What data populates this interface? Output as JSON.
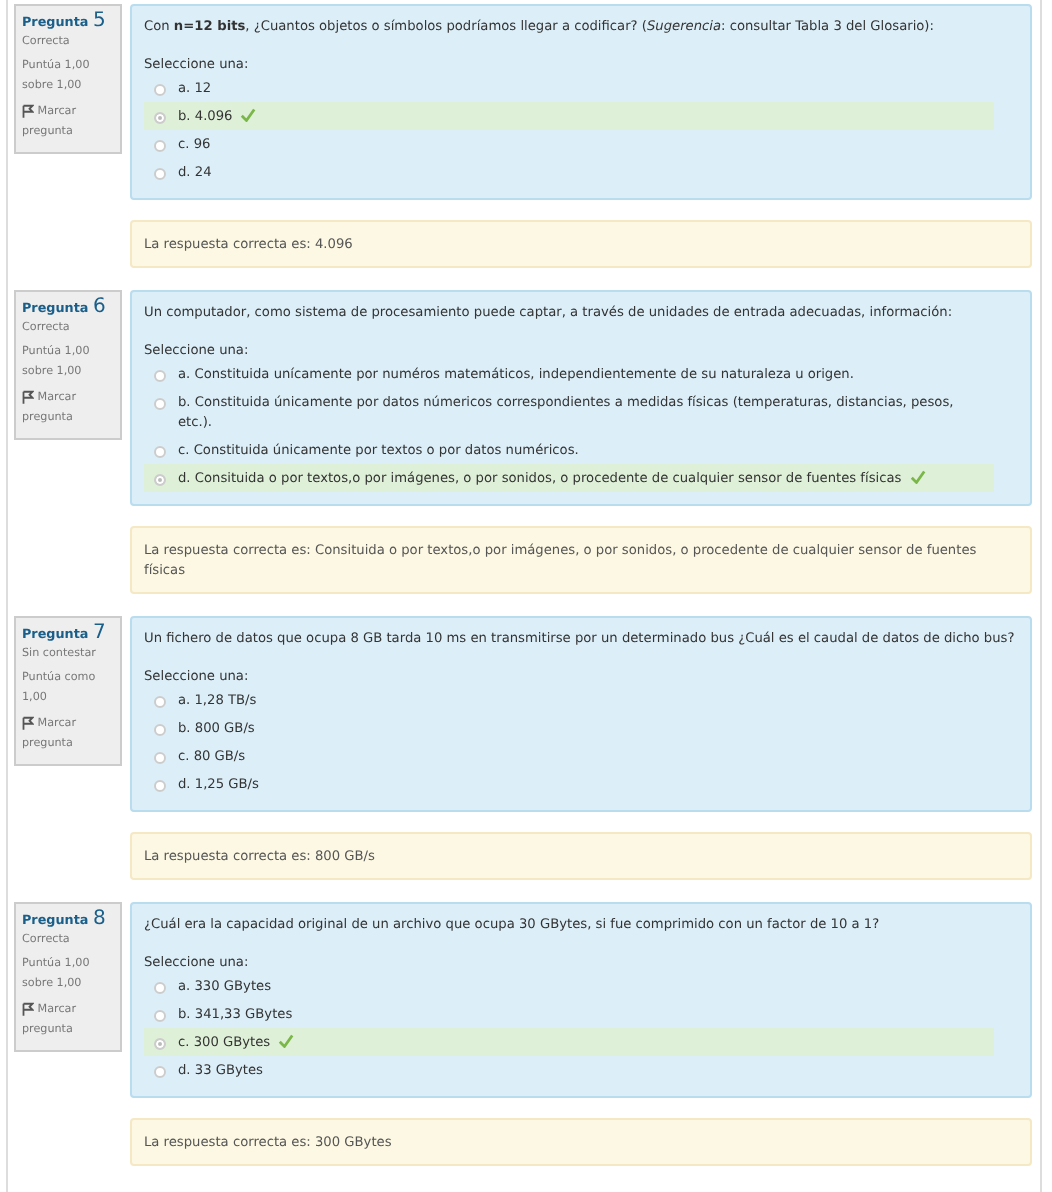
{
  "questions": [
    {
      "label": "Pregunta",
      "number": "5",
      "state": "Correcta",
      "grade": "Puntúa 1,00 sobre 1,00",
      "flag": "Marcar pregunta",
      "prompt": "Con **n=12 bits**, ¿Cuantos objetos o símbolos podríamos llegar a codificar? (*Sugerencia*: consultar Tabla 3 del Glosario):",
      "select_label": "Seleccione una:",
      "options": [
        {
          "label": "a. 12",
          "selected": false
        },
        {
          "label": "b. 4.096",
          "selected": true
        },
        {
          "label": "c. 96",
          "selected": false
        },
        {
          "label": "d. 24",
          "selected": false
        }
      ],
      "feedback": "La respuesta correcta es: 4.096"
    },
    {
      "label": "Pregunta",
      "number": "6",
      "state": "Correcta",
      "grade": "Puntúa 1,00 sobre 1,00",
      "flag": "Marcar pregunta",
      "prompt": "Un computador, como sistema de procesamiento puede captar, a través de unidades de entrada adecuadas, información:",
      "select_label": "Seleccione una:",
      "options": [
        {
          "label": "a. Constituida unícamente por numéros matemáticos, independientemente de su naturaleza u origen.",
          "selected": false
        },
        {
          "label": "b. Constituida únicamente por datos númericos correspondientes a medidas físicas (temperaturas, distancias, pesos, etc.).",
          "selected": false
        },
        {
          "label": "c. Constituida únicamente por textos o por datos numéricos.",
          "selected": false
        },
        {
          "label": "d. Consituida o por textos,o por imágenes, o por sonidos, o procedente de cualquier sensor de fuentes físicas",
          "selected": true
        }
      ],
      "feedback": "La respuesta correcta es: Consituida o por textos,o por imágenes, o por sonidos, o procedente de cualquier sensor de fuentes físicas"
    },
    {
      "label": "Pregunta",
      "number": "7",
      "state": "Sin contestar",
      "grade": "Puntúa como 1,00",
      "flag": "Marcar pregunta",
      "prompt": "Un fichero de datos que ocupa 8 GB tarda 10 ms en transmitirse por un determinado bus ¿Cuál es el caudal de datos de dicho bus?",
      "select_label": "Seleccione una:",
      "options": [
        {
          "label": "a. 1,28 TB/s",
          "selected": false
        },
        {
          "label": "b. 800 GB/s",
          "selected": false
        },
        {
          "label": "c. 80 GB/s",
          "selected": false
        },
        {
          "label": "d. 1,25 GB/s",
          "selected": false
        }
      ],
      "feedback": "La respuesta correcta es: 800 GB/s"
    },
    {
      "label": "Pregunta",
      "number": "8",
      "state": "Correcta",
      "grade": "Puntúa 1,00 sobre 1,00",
      "flag": "Marcar pregunta",
      "prompt": "¿Cuál era la capacidad original de un archivo que ocupa 30 GBytes, si fue comprimido con un factor de 10 a 1?",
      "select_label": "Seleccione una:",
      "options": [
        {
          "label": "a. 330 GBytes",
          "selected": false
        },
        {
          "label": "b. 341,33 GBytes",
          "selected": false
        },
        {
          "label": "c. 300 GBytes",
          "selected": true
        },
        {
          "label": "d. 33 GBytes",
          "selected": false
        }
      ],
      "feedback": "La respuesta correcta es: 300 GBytes"
    }
  ]
}
